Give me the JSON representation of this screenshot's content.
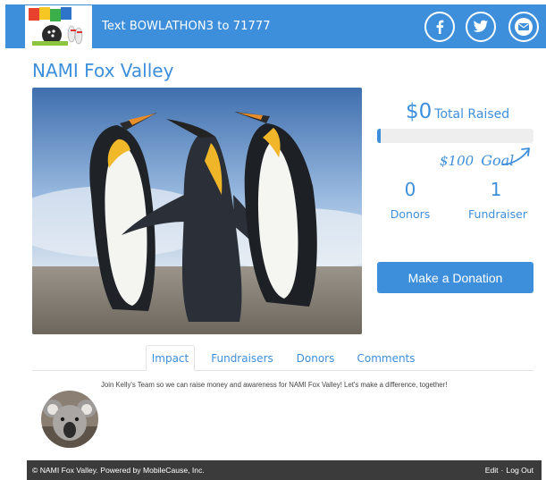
{
  "header": {
    "sms_text": "Text BOWLATHON3 to 71777",
    "social": [
      {
        "icon": "facebook-icon"
      },
      {
        "icon": "twitter-icon"
      },
      {
        "icon": "email-icon"
      }
    ],
    "background_color": "#3d8fdc"
  },
  "campaign": {
    "title": "NAMI Fox Valley"
  },
  "stats": {
    "amount_raised": "$0",
    "raised_label": "Total Raised",
    "progress_fraction": 0.01,
    "goal_amount": "$100",
    "goal_label": "Goal",
    "donors_count": "0",
    "donors_label": "Donors",
    "fundraisers_count": "1",
    "fundraisers_label": "Fundraiser"
  },
  "donate_button": "Make a Donation",
  "tabs": [
    {
      "label": "Impact",
      "active": true
    },
    {
      "label": "Fundraisers",
      "active": false
    },
    {
      "label": "Donors",
      "active": false
    },
    {
      "label": "Comments",
      "active": false
    }
  ],
  "impact": {
    "text": "Join Kelly's Team so we can raise money and awareness for NAMI Fox Valley! Let's make a difference, together!"
  },
  "footer": {
    "copyright": "© NAMI Fox Valley. Powered by MobileCause, Inc.",
    "edit_link": "Edit",
    "logout_link": "Log Out"
  },
  "colors": {
    "accent": "#3d8fdc",
    "footer_bg": "#3b3b3b"
  }
}
